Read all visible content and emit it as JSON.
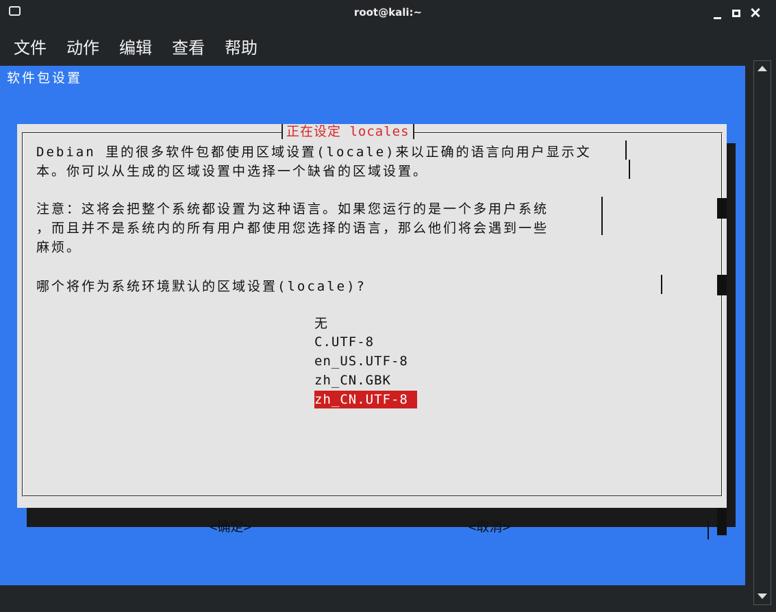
{
  "window": {
    "title": "root@kali:~",
    "controls": [
      "minimize-icon",
      "maximize-icon",
      "close-icon"
    ]
  },
  "menu": {
    "items": [
      {
        "label": "文件"
      },
      {
        "label": "动作"
      },
      {
        "label": "编辑"
      },
      {
        "label": "查看"
      },
      {
        "label": "帮助"
      }
    ]
  },
  "terminal": {
    "backtitle": "软件包设置",
    "dialog": {
      "title": "正在设定 locales",
      "lines": [
        "Debian 里的很多软件包都使用区域设置(locale)来以正确的语言向用户显示文",
        "本。你可以从生成的区域设置中选择一个缺省的区域设置。",
        "注意：这将会把整个系统都设置为这种语言。如果您运行的是一个多用户系统",
        "，而且并不是系统内的所有用户都使用您选择的语言，那么他们将会遇到一些",
        "麻烦。",
        "哪个将作为系统环境默认的区域设置(locale)?"
      ],
      "options": [
        {
          "label": "无",
          "selected": false
        },
        {
          "label": "C.UTF-8",
          "selected": false
        },
        {
          "label": "en_US.UTF-8",
          "selected": false
        },
        {
          "label": "zh_CN.GBK",
          "selected": false
        },
        {
          "label": "zh_CN.UTF-8",
          "selected": true
        }
      ],
      "buttons": {
        "ok": "<确定>",
        "cancel": "<取消>"
      }
    }
  },
  "colors": {
    "background": "#3279ef",
    "dialog": "#e4e4e4",
    "title_text": "#d9262a",
    "selection": "#cd1f1f"
  }
}
